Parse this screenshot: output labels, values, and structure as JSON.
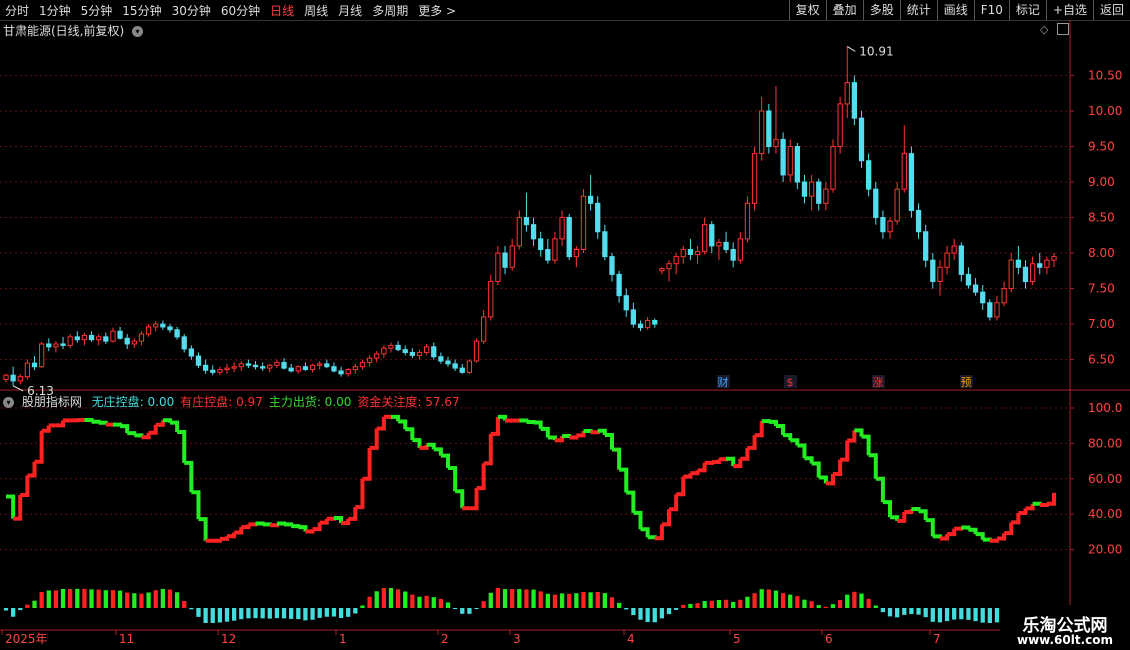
{
  "toolbar": {
    "periods": [
      {
        "label": "分时",
        "active": false
      },
      {
        "label": "1分钟",
        "active": false
      },
      {
        "label": "5分钟",
        "active": false
      },
      {
        "label": "15分钟",
        "active": false
      },
      {
        "label": "30分钟",
        "active": false
      },
      {
        "label": "60分钟",
        "active": false
      },
      {
        "label": "日线",
        "active": true
      },
      {
        "label": "周线",
        "active": false
      },
      {
        "label": "月线",
        "active": false
      },
      {
        "label": "多周期",
        "active": false
      },
      {
        "label": "更多 >",
        "active": false
      }
    ],
    "right_buttons": [
      "复权",
      "叠加",
      "多股",
      "统计",
      "画线",
      "F10",
      "标记",
      "+自选",
      "返回"
    ]
  },
  "main_panel": {
    "title": "甘肃能源(日线,前复权)",
    "y_ticks": [
      "10.50",
      "10.00",
      "9.50",
      "9.00",
      "8.50",
      "8.00",
      "7.50",
      "7.00",
      "6.50"
    ],
    "high_label": "10.91",
    "low_label": "6.13",
    "event_markers": [
      {
        "label": "财",
        "color": "#3aa0ff"
      },
      {
        "label": "$",
        "color": "#ff3030"
      },
      {
        "label": "涨",
        "color": "#ff3030"
      },
      {
        "label": "预",
        "color": "#ff9900"
      }
    ]
  },
  "indicator_panel": {
    "name": "股朋指标网",
    "values": [
      {
        "label": "无庄控盘: 0.00",
        "color": "#44dddd"
      },
      {
        "label": "有庄控盘: 0.97",
        "color": "#ff3030"
      },
      {
        "label": "主力出货: 0.00",
        "color": "#33dd33"
      },
      {
        "label": "资金关注度: 57.67",
        "color": "#ff3030"
      }
    ],
    "y_ticks": [
      "100.0",
      "80.00",
      "60.00",
      "40.00",
      "20.00"
    ]
  },
  "x_axis": {
    "labels": [
      "2025年",
      "11",
      "12",
      "1",
      "2",
      "3",
      "4",
      "5",
      "6",
      "7"
    ]
  },
  "watermark": {
    "title": "乐淘公式网",
    "url": "www.60lt.com"
  },
  "chart_data": {
    "type": "candlestick",
    "ylim": [
      6.1,
      11.0
    ],
    "indicator_ylim": [
      0,
      100
    ],
    "candles": [
      [
        6.22,
        6.3,
        6.18,
        6.28
      ],
      [
        6.28,
        6.4,
        6.13,
        6.2
      ],
      [
        6.2,
        6.3,
        6.15,
        6.26
      ],
      [
        6.26,
        6.5,
        6.22,
        6.45
      ],
      [
        6.45,
        6.55,
        6.35,
        6.4
      ],
      [
        6.4,
        6.75,
        6.38,
        6.72
      ],
      [
        6.72,
        6.8,
        6.62,
        6.68
      ],
      [
        6.68,
        6.76,
        6.6,
        6.72
      ],
      [
        6.72,
        6.82,
        6.65,
        6.7
      ],
      [
        6.7,
        6.86,
        6.66,
        6.82
      ],
      [
        6.82,
        6.9,
        6.74,
        6.78
      ],
      [
        6.78,
        6.88,
        6.7,
        6.84
      ],
      [
        6.84,
        6.9,
        6.75,
        6.78
      ],
      [
        6.78,
        6.86,
        6.7,
        6.82
      ],
      [
        6.82,
        6.88,
        6.72,
        6.76
      ],
      [
        6.76,
        6.95,
        6.74,
        6.9
      ],
      [
        6.9,
        6.96,
        6.78,
        6.8
      ],
      [
        6.8,
        6.86,
        6.65,
        6.72
      ],
      [
        6.72,
        6.8,
        6.66,
        6.76
      ],
      [
        6.76,
        6.9,
        6.7,
        6.86
      ],
      [
        6.86,
        7.0,
        6.82,
        6.96
      ],
      [
        6.96,
        7.04,
        6.9,
        7.0
      ],
      [
        7.0,
        7.05,
        6.92,
        6.96
      ],
      [
        6.96,
        7.0,
        6.88,
        6.92
      ],
      [
        6.92,
        6.96,
        6.78,
        6.82
      ],
      [
        6.82,
        6.86,
        6.6,
        6.65
      ],
      [
        6.65,
        6.7,
        6.5,
        6.55
      ],
      [
        6.55,
        6.6,
        6.38,
        6.42
      ],
      [
        6.42,
        6.5,
        6.3,
        6.35
      ],
      [
        6.35,
        6.42,
        6.28,
        6.32
      ],
      [
        6.32,
        6.4,
        6.28,
        6.36
      ],
      [
        6.36,
        6.44,
        6.3,
        6.38
      ],
      [
        6.38,
        6.46,
        6.32,
        6.4
      ],
      [
        6.4,
        6.48,
        6.34,
        6.44
      ],
      [
        6.44,
        6.5,
        6.38,
        6.42
      ],
      [
        6.42,
        6.48,
        6.36,
        6.4
      ],
      [
        6.4,
        6.46,
        6.34,
        6.38
      ],
      [
        6.38,
        6.44,
        6.32,
        6.42
      ],
      [
        6.42,
        6.5,
        6.38,
        6.46
      ],
      [
        6.46,
        6.52,
        6.36,
        6.38
      ],
      [
        6.38,
        6.44,
        6.32,
        6.34
      ],
      [
        6.34,
        6.42,
        6.3,
        6.4
      ],
      [
        6.4,
        6.46,
        6.34,
        6.36
      ],
      [
        6.36,
        6.44,
        6.32,
        6.42
      ],
      [
        6.42,
        6.48,
        6.36,
        6.44
      ],
      [
        6.44,
        6.5,
        6.38,
        6.4
      ],
      [
        6.4,
        6.46,
        6.32,
        6.34
      ],
      [
        6.34,
        6.4,
        6.26,
        6.3
      ],
      [
        6.3,
        6.38,
        6.26,
        6.36
      ],
      [
        6.36,
        6.44,
        6.3,
        6.4
      ],
      [
        6.4,
        6.5,
        6.36,
        6.46
      ],
      [
        6.46,
        6.56,
        6.4,
        6.52
      ],
      [
        6.52,
        6.62,
        6.46,
        6.58
      ],
      [
        6.58,
        6.7,
        6.52,
        6.66
      ],
      [
        6.66,
        6.74,
        6.6,
        6.7
      ],
      [
        6.7,
        6.76,
        6.62,
        6.64
      ],
      [
        6.64,
        6.7,
        6.56,
        6.6
      ],
      [
        6.6,
        6.66,
        6.52,
        6.56
      ],
      [
        6.56,
        6.64,
        6.5,
        6.6
      ],
      [
        6.6,
        6.72,
        6.56,
        6.68
      ],
      [
        6.68,
        6.74,
        6.5,
        6.54
      ],
      [
        6.54,
        6.6,
        6.44,
        6.48
      ],
      [
        6.48,
        6.54,
        6.4,
        6.44
      ],
      [
        6.44,
        6.5,
        6.34,
        6.38
      ],
      [
        6.38,
        6.44,
        6.3,
        6.32
      ],
      [
        6.32,
        6.5,
        6.3,
        6.48
      ],
      [
        6.48,
        6.8,
        6.46,
        6.76
      ],
      [
        6.76,
        7.2,
        6.72,
        7.1
      ],
      [
        7.1,
        7.7,
        7.05,
        7.6
      ],
      [
        7.6,
        8.1,
        7.55,
        8.0
      ],
      [
        8.0,
        8.1,
        7.7,
        7.8
      ],
      [
        7.8,
        8.2,
        7.75,
        8.1
      ],
      [
        8.1,
        8.6,
        8.05,
        8.5
      ],
      [
        8.5,
        8.85,
        8.3,
        8.4
      ],
      [
        8.4,
        8.5,
        8.1,
        8.2
      ],
      [
        8.2,
        8.3,
        7.95,
        8.05
      ],
      [
        8.05,
        8.2,
        7.85,
        7.9
      ],
      [
        7.9,
        8.3,
        7.85,
        8.2
      ],
      [
        8.2,
        8.6,
        8.1,
        8.5
      ],
      [
        8.5,
        8.55,
        7.9,
        7.95
      ],
      [
        7.95,
        8.1,
        7.8,
        8.05
      ],
      [
        8.05,
        8.9,
        8.0,
        8.8
      ],
      [
        8.8,
        9.1,
        8.6,
        8.7
      ],
      [
        8.7,
        8.8,
        8.2,
        8.3
      ],
      [
        8.3,
        8.4,
        7.9,
        7.95
      ],
      [
        7.95,
        8.0,
        7.6,
        7.7
      ],
      [
        7.7,
        7.75,
        7.3,
        7.4
      ],
      [
        7.4,
        7.5,
        7.1,
        7.2
      ],
      [
        7.2,
        7.3,
        6.95,
        7.0
      ],
      [
        7.0,
        7.05,
        6.9,
        6.95
      ],
      [
        6.95,
        7.1,
        6.92,
        7.05
      ],
      [
        7.05,
        7.08,
        6.95,
        7.0
      ],
      [
        7.75,
        7.8,
        7.7,
        7.78
      ],
      [
        7.78,
        7.9,
        7.6,
        7.85
      ],
      [
        7.85,
        8.0,
        7.7,
        7.95
      ],
      [
        7.95,
        8.1,
        7.85,
        8.05
      ],
      [
        8.05,
        8.2,
        7.9,
        7.98
      ],
      [
        7.98,
        8.1,
        7.85,
        8.02
      ],
      [
        8.02,
        8.5,
        7.98,
        8.4
      ],
      [
        8.4,
        8.45,
        8.0,
        8.1
      ],
      [
        8.1,
        8.2,
        7.9,
        8.15
      ],
      [
        8.15,
        8.3,
        8.0,
        8.05
      ],
      [
        8.05,
        8.15,
        7.8,
        7.9
      ],
      [
        7.9,
        8.3,
        7.85,
        8.2
      ],
      [
        8.2,
        8.8,
        8.15,
        8.7
      ],
      [
        8.7,
        9.5,
        8.6,
        9.4
      ],
      [
        9.4,
        10.2,
        9.3,
        10.0
      ],
      [
        10.0,
        10.1,
        9.4,
        9.5
      ],
      [
        9.5,
        10.35,
        9.4,
        9.6
      ],
      [
        9.6,
        9.7,
        9.0,
        9.1
      ],
      [
        9.1,
        9.6,
        9.0,
        9.5
      ],
      [
        9.5,
        9.55,
        8.9,
        9.0
      ],
      [
        9.0,
        9.1,
        8.7,
        8.8
      ],
      [
        8.8,
        9.1,
        8.6,
        9.0
      ],
      [
        9.0,
        9.05,
        8.6,
        8.7
      ],
      [
        8.7,
        9.0,
        8.6,
        8.9
      ],
      [
        8.9,
        9.6,
        8.85,
        9.5
      ],
      [
        9.5,
        10.2,
        9.4,
        10.1
      ],
      [
        10.1,
        10.91,
        9.9,
        10.4
      ],
      [
        10.4,
        10.5,
        9.8,
        9.9
      ],
      [
        9.9,
        10.0,
        9.2,
        9.3
      ],
      [
        9.3,
        9.4,
        8.8,
        8.9
      ],
      [
        8.9,
        9.0,
        8.4,
        8.5
      ],
      [
        8.5,
        8.6,
        8.2,
        8.3
      ],
      [
        8.3,
        8.5,
        8.2,
        8.45
      ],
      [
        8.45,
        9.0,
        8.4,
        8.9
      ],
      [
        8.9,
        9.8,
        8.85,
        9.4
      ],
      [
        9.4,
        9.5,
        8.5,
        8.6
      ],
      [
        8.6,
        8.7,
        8.2,
        8.3
      ],
      [
        8.3,
        8.4,
        7.8,
        7.9
      ],
      [
        7.9,
        8.0,
        7.5,
        7.6
      ],
      [
        7.6,
        7.9,
        7.4,
        7.8
      ],
      [
        7.8,
        8.1,
        7.7,
        8.0
      ],
      [
        8.0,
        8.2,
        7.9,
        8.1
      ],
      [
        8.1,
        8.15,
        7.6,
        7.7
      ],
      [
        7.7,
        7.8,
        7.5,
        7.55
      ],
      [
        7.55,
        7.65,
        7.4,
        7.45
      ],
      [
        7.45,
        7.55,
        7.2,
        7.3
      ],
      [
        7.3,
        7.35,
        7.05,
        7.1
      ],
      [
        7.1,
        7.4,
        7.05,
        7.3
      ],
      [
        7.3,
        7.6,
        7.25,
        7.5
      ],
      [
        7.5,
        8.0,
        7.45,
        7.9
      ],
      [
        7.9,
        8.1,
        7.7,
        7.8
      ],
      [
        7.8,
        7.9,
        7.5,
        7.6
      ],
      [
        7.6,
        7.95,
        7.55,
        7.85
      ],
      [
        7.85,
        8.0,
        7.7,
        7.8
      ],
      [
        7.8,
        7.95,
        7.7,
        7.9
      ],
      [
        7.9,
        8.0,
        7.8,
        7.95
      ]
    ]
  }
}
